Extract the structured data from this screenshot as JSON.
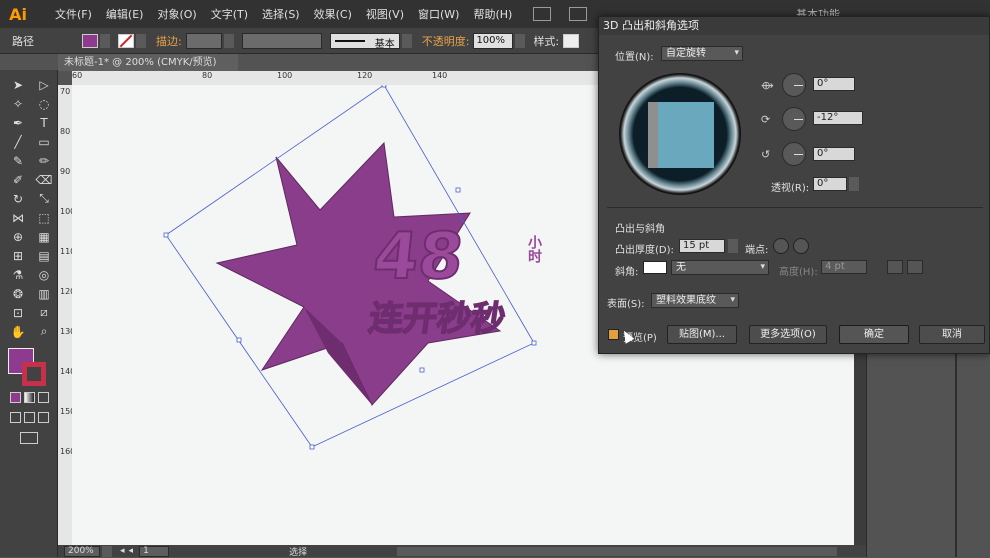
{
  "app": {
    "logo": "Ai",
    "workspace": "基本功能"
  },
  "menu": [
    "文件(F)",
    "编辑(E)",
    "对象(O)",
    "文字(T)",
    "选择(S)",
    "效果(C)",
    "视图(V)",
    "窗口(W)",
    "帮助(H)"
  ],
  "control": {
    "selection_label": "路径",
    "stroke_label": "描边:",
    "brush_label": "基本",
    "opacity_label": "不透明度:",
    "opacity_value": "100%",
    "style_label": "样式:",
    "fill_color": "#8e3a8e"
  },
  "document": {
    "tab_title": "未标题-1* @ 200% (CMYK/预览)"
  },
  "ruler": {
    "top": [
      "60",
      "80",
      "100",
      "120",
      "140"
    ],
    "left": [
      "70",
      "80",
      "90",
      "100",
      "110",
      "120",
      "130",
      "140",
      "150",
      "160"
    ]
  },
  "status": {
    "zoom": "200%",
    "page": "1",
    "tool": "选择"
  },
  "artwork": {
    "text_big": "48",
    "text_small": "小时",
    "text_bottom": "连开秒秒",
    "color": "#8e3a8e"
  },
  "dialog": {
    "title": "3D 凸出和斜角选项",
    "position_label": "位置(N):",
    "position_value": "自定旋转",
    "rot_x": "0°",
    "rot_y": "-12°",
    "rot_z": "0°",
    "perspective_label": "透视(R):",
    "perspective_value": "0°",
    "extrude_section": "凸出与斜角",
    "depth_label": "凸出厚度(D):",
    "depth_value": "15 pt",
    "cap_label": "端点:",
    "bevel_label": "斜角:",
    "bevel_value": "无",
    "height_label": "高度(H):",
    "height_value": "4 pt",
    "surface_label": "表面(S):",
    "surface_value": "塑料效果底纹",
    "preview_label": "预览(P)",
    "map_button": "贴图(M)...",
    "more_button": "更多选项(O)",
    "ok_button": "确定",
    "cancel_button": "取消"
  }
}
